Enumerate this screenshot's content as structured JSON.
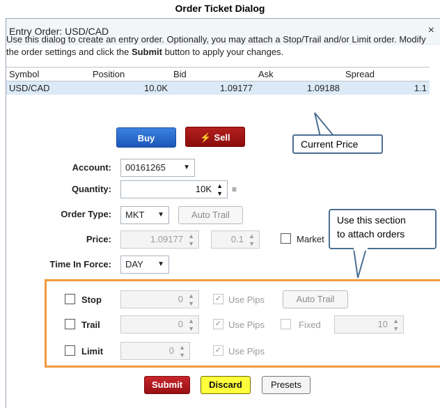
{
  "doc_title": "Order Ticket Dialog",
  "window": {
    "title": "Entry Order: USD/CAD",
    "close_glyph": "×"
  },
  "description": {
    "part1": "Use this dialog to create an entry order. Optionally, you may attach a Stop/Trail and/or Limit order. Modify the order settings and click the ",
    "bold": "Submit",
    "part2": " button to apply your changes."
  },
  "quote": {
    "headers": [
      "Symbol",
      "Position",
      "Bid",
      "Ask",
      "Spread"
    ],
    "row": {
      "symbol": "USD/CAD",
      "position": "10.0K",
      "bid": "1.09177",
      "ask": "1.09188",
      "spread": "1.1"
    }
  },
  "trade_buttons": {
    "buy": "Buy",
    "sell": "Sell",
    "sell_icon": "lightning-bolt-icon"
  },
  "callouts": {
    "current_price": "Current Price",
    "attach_line1": "Use this section",
    "attach_line2": "to attach orders"
  },
  "form": {
    "account_label": "Account:",
    "account_value": "00161265",
    "quantity_label": "Quantity:",
    "quantity_value": "10K",
    "order_type_label": "Order Type:",
    "order_type_value": "MKT",
    "auto_trail": "Auto Trail",
    "price_label": "Price:",
    "price_value": "1.09177",
    "price_step": "0.1",
    "market_label": "Market",
    "tif_label": "Time In Force:",
    "tif_value": "DAY"
  },
  "attached": {
    "stop": {
      "label": "Stop",
      "value": "0",
      "use_pips": "Use Pips",
      "auto_trail": "Auto Trail"
    },
    "trail": {
      "label": "Trail",
      "value": "0",
      "use_pips": "Use Pips",
      "fixed": "Fixed",
      "fixed_value": "10"
    },
    "limit": {
      "label": "Limit",
      "value": "0",
      "use_pips": "Use Pips"
    }
  },
  "bottom_buttons": {
    "submit": "Submit",
    "discard": "Discard",
    "presets": "Presets"
  },
  "colors": {
    "attach_box": "#f19a3e",
    "buy": "#1c56b8",
    "sell": "#8a0d0d",
    "discard": "#ffff3c"
  }
}
